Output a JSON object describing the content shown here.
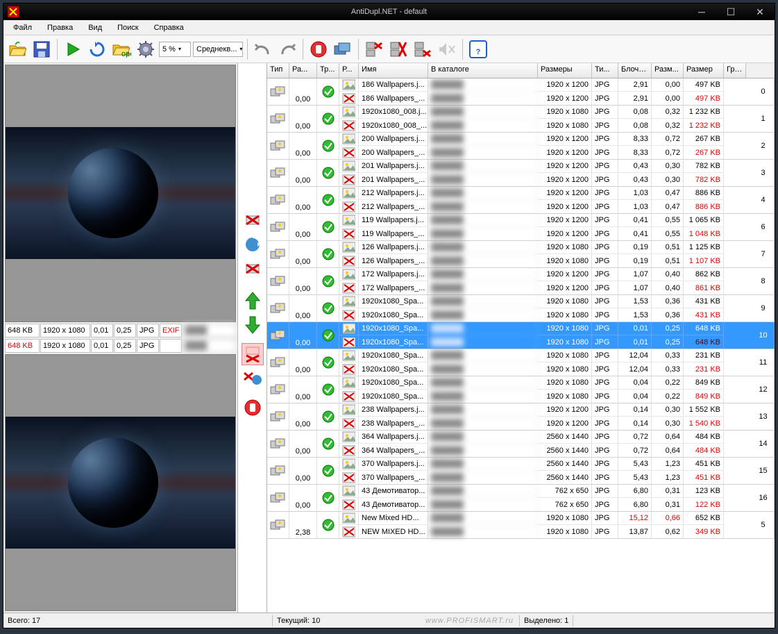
{
  "title": "AntiDupl.NET - default",
  "menu": {
    "file": "Файл",
    "edit": "Правка",
    "view": "Вид",
    "search": "Поиск",
    "help": "Справка"
  },
  "toolbar": {
    "threshold": "5 %",
    "quality": "Среднекв..."
  },
  "columns": {
    "type": "Тип",
    "diff": "Ра...",
    "transform": "Тр...",
    "r": "Р...",
    "name": "Имя",
    "folder": "В каталоге",
    "dimensions": "Размеры",
    "ext": "Ти...",
    "block": "Блочн...",
    "ratio": "Разм...",
    "size": "Размер",
    "group": "Гру..."
  },
  "colw": {
    "type": 32,
    "diff": 40,
    "transform": 32,
    "r": 28,
    "name": 100,
    "folder": 158,
    "dimensions": 78,
    "ext": 38,
    "block": 48,
    "ratio": 46,
    "size": 58,
    "group": 32
  },
  "rows": [
    {
      "diff": "0,00",
      "group": "0",
      "a": {
        "name": "186 Wallpapers.j...",
        "dim": "1920 x 1200",
        "ext": "JPG",
        "block": "2,91",
        "ratio": "0,00",
        "size": "497 KB",
        "red": false
      },
      "b": {
        "name": "186 Wallpapers_...",
        "dim": "1920 x 1200",
        "ext": "JPG",
        "block": "2,91",
        "ratio": "0,00",
        "size": "497 KB",
        "red": true
      }
    },
    {
      "diff": "0,00",
      "group": "1",
      "a": {
        "name": "1920x1080_008.j...",
        "dim": "1920 x 1080",
        "ext": "JPG",
        "block": "0,08",
        "ratio": "0,32",
        "size": "1 232 KB",
        "red": false
      },
      "b": {
        "name": "1920x1080_008_...",
        "dim": "1920 x 1080",
        "ext": "JPG",
        "block": "0,08",
        "ratio": "0,32",
        "size": "1 232 KB",
        "red": true
      }
    },
    {
      "diff": "0,00",
      "group": "2",
      "a": {
        "name": "200 Wallpapers.j...",
        "dim": "1920 x 1200",
        "ext": "JPG",
        "block": "8,33",
        "ratio": "0,72",
        "size": "267 KB",
        "red": false
      },
      "b": {
        "name": "200 Wallpapers_...",
        "dim": "1920 x 1200",
        "ext": "JPG",
        "block": "8,33",
        "ratio": "0,72",
        "size": "267 KB",
        "red": true
      }
    },
    {
      "diff": "0,00",
      "group": "3",
      "a": {
        "name": "201 Wallpapers.j...",
        "dim": "1920 x 1200",
        "ext": "JPG",
        "block": "0,43",
        "ratio": "0,30",
        "size": "782 KB",
        "red": false
      },
      "b": {
        "name": "201 Wallpapers_...",
        "dim": "1920 x 1200",
        "ext": "JPG",
        "block": "0,43",
        "ratio": "0,30",
        "size": "782 KB",
        "red": true
      }
    },
    {
      "diff": "0,00",
      "group": "4",
      "a": {
        "name": "212 Wallpapers.j...",
        "dim": "1920 x 1200",
        "ext": "JPG",
        "block": "1,03",
        "ratio": "0,47",
        "size": "886 KB",
        "red": false
      },
      "b": {
        "name": "212 Wallpapers_...",
        "dim": "1920 x 1200",
        "ext": "JPG",
        "block": "1,03",
        "ratio": "0,47",
        "size": "886 KB",
        "red": true
      }
    },
    {
      "diff": "0,00",
      "group": "6",
      "a": {
        "name": "119 Wallpapers.j...",
        "dim": "1920 x 1200",
        "ext": "JPG",
        "block": "0,41",
        "ratio": "0,55",
        "size": "1 065 KB",
        "red": false
      },
      "b": {
        "name": "119 Wallpapers_...",
        "dim": "1920 x 1200",
        "ext": "JPG",
        "block": "0,41",
        "ratio": "0,55",
        "size": "1 048 KB",
        "red": true
      }
    },
    {
      "diff": "0,00",
      "group": "7",
      "a": {
        "name": "126 Wallpapers.j...",
        "dim": "1920 x 1080",
        "ext": "JPG",
        "block": "0,19",
        "ratio": "0,51",
        "size": "1 125 KB",
        "red": false
      },
      "b": {
        "name": "126 Wallpapers_...",
        "dim": "1920 x 1080",
        "ext": "JPG",
        "block": "0,19",
        "ratio": "0,51",
        "size": "1 107 KB",
        "red": true
      }
    },
    {
      "diff": "0,00",
      "group": "8",
      "a": {
        "name": "172 Wallpapers.j...",
        "dim": "1920 x 1200",
        "ext": "JPG",
        "block": "1,07",
        "ratio": "0,40",
        "size": "862 KB",
        "red": false
      },
      "b": {
        "name": "172 Wallpapers_...",
        "dim": "1920 x 1200",
        "ext": "JPG",
        "block": "1,07",
        "ratio": "0,40",
        "size": "861 KB",
        "red": true
      }
    },
    {
      "diff": "0,00",
      "group": "9",
      "a": {
        "name": "1920x1080_Spa...",
        "dim": "1920 x 1080",
        "ext": "JPG",
        "block": "1,53",
        "ratio": "0,36",
        "size": "431 KB",
        "red": false
      },
      "b": {
        "name": "1920x1080_Spa...",
        "dim": "1920 x 1080",
        "ext": "JPG",
        "block": "1,53",
        "ratio": "0,36",
        "size": "431 KB",
        "red": true
      }
    },
    {
      "diff": "0,00",
      "group": "10",
      "selected": true,
      "a": {
        "name": "1920x1080_Spa...",
        "dim": "1920 x 1080",
        "ext": "JPG",
        "block": "0,01",
        "ratio": "0,25",
        "size": "648 KB",
        "red": false
      },
      "b": {
        "name": "1920x1080_Spa...",
        "dim": "1920 x 1080",
        "ext": "JPG",
        "block": "0,01",
        "ratio": "0,25",
        "size": "648 KB",
        "red": true
      }
    },
    {
      "diff": "0,00",
      "group": "11",
      "a": {
        "name": "1920x1080_Spa...",
        "dim": "1920 x 1080",
        "ext": "JPG",
        "block": "12,04",
        "ratio": "0,33",
        "size": "231 KB",
        "red": false
      },
      "b": {
        "name": "1920x1080_Spa...",
        "dim": "1920 x 1080",
        "ext": "JPG",
        "block": "12,04",
        "ratio": "0,33",
        "size": "231 KB",
        "red": true
      }
    },
    {
      "diff": "0,00",
      "group": "12",
      "a": {
        "name": "1920x1080_Spa...",
        "dim": "1920 x 1080",
        "ext": "JPG",
        "block": "0,04",
        "ratio": "0,22",
        "size": "849 KB",
        "red": false
      },
      "b": {
        "name": "1920x1080_Spa...",
        "dim": "1920 x 1080",
        "ext": "JPG",
        "block": "0,04",
        "ratio": "0,22",
        "size": "849 KB",
        "red": true
      }
    },
    {
      "diff": "0,00",
      "group": "13",
      "a": {
        "name": "238 Wallpapers.j...",
        "dim": "1920 x 1200",
        "ext": "JPG",
        "block": "0,14",
        "ratio": "0,30",
        "size": "1 552 KB",
        "red": false
      },
      "b": {
        "name": "238 Wallpapers_...",
        "dim": "1920 x 1200",
        "ext": "JPG",
        "block": "0,14",
        "ratio": "0,30",
        "size": "1 540 KB",
        "red": true
      }
    },
    {
      "diff": "0,00",
      "group": "14",
      "a": {
        "name": "364 Wallpapers.j...",
        "dim": "2560 x 1440",
        "ext": "JPG",
        "block": "0,72",
        "ratio": "0,64",
        "size": "484 KB",
        "red": false
      },
      "b": {
        "name": "364 Wallpapers_...",
        "dim": "2560 x 1440",
        "ext": "JPG",
        "block": "0,72",
        "ratio": "0,64",
        "size": "484 KB",
        "red": true
      }
    },
    {
      "diff": "0,00",
      "group": "15",
      "a": {
        "name": "370 Wallpapers.j...",
        "dim": "2560 x 1440",
        "ext": "JPG",
        "block": "5,43",
        "ratio": "1,23",
        "size": "451 KB",
        "red": false
      },
      "b": {
        "name": "370 Wallpapers_...",
        "dim": "2560 x 1440",
        "ext": "JPG",
        "block": "5,43",
        "ratio": "1,23",
        "size": "451 KB",
        "red": true
      }
    },
    {
      "diff": "0,00",
      "group": "16",
      "a": {
        "name": "43 Демотиватор...",
        "dim": "762 x 650",
        "ext": "JPG",
        "block": "6,80",
        "ratio": "0,31",
        "size": "123 KB",
        "red": false
      },
      "b": {
        "name": "43 Демотиватор...",
        "dim": "762 x 650",
        "ext": "JPG",
        "block": "6,80",
        "ratio": "0,31",
        "size": "122 KB",
        "red": true
      }
    },
    {
      "diff": "2,38",
      "group": "5",
      "a": {
        "name": "New Mixed HD...",
        "dim": "1920 x 1080",
        "ext": "JPG",
        "block": "15,12",
        "ratio": "0,66",
        "size": "652 KB",
        "red": false,
        "blockred": true,
        "ratiored": true
      },
      "b": {
        "name": "NEW MIXED HD...",
        "dim": "1920 x 1080",
        "ext": "JPG",
        "block": "13,87",
        "ratio": "0,62",
        "size": "349 KB",
        "red": true
      }
    }
  ],
  "info1": {
    "size": "648 KB",
    "dim": "1920 x 1080",
    "v1": "0,01",
    "v2": "0,25",
    "ext": "JPG",
    "exif": "EXIF"
  },
  "info2": {
    "size": "648 KB",
    "dim": "1920 x 1080",
    "v1": "0,01",
    "v2": "0,25",
    "ext": "JPG",
    "exif": ""
  },
  "status": {
    "total_label": "Всего:",
    "total": "17",
    "current_label": "Текущий:",
    "current": "10",
    "selected_label": "Выделено:",
    "selected": "1",
    "watermark": "www.PROFISMART.ru"
  }
}
